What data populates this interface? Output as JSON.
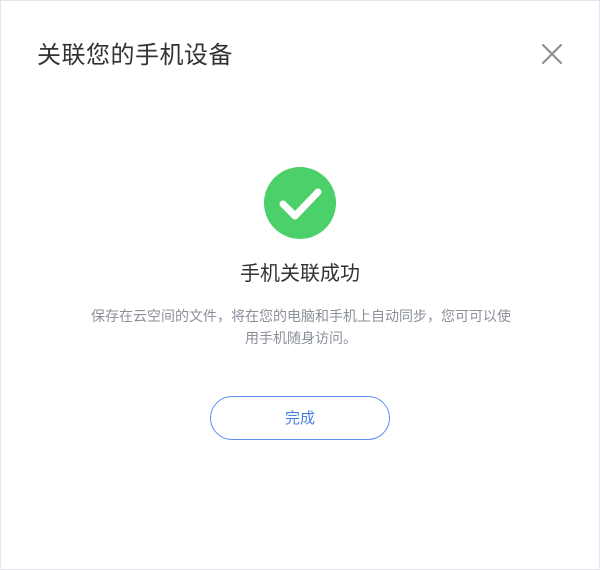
{
  "dialog": {
    "title": "关联您的手机设备",
    "close_icon": "close-icon",
    "success_icon": "check-circle-icon",
    "success_color": "#4cd069",
    "headline": "手机关联成功",
    "description": "保存在云空间的文件，将在您的电脑和手机上自动同步，您可可以使用手机随身访问。",
    "done_label": "完成",
    "accent_color": "#4a7fe6"
  }
}
